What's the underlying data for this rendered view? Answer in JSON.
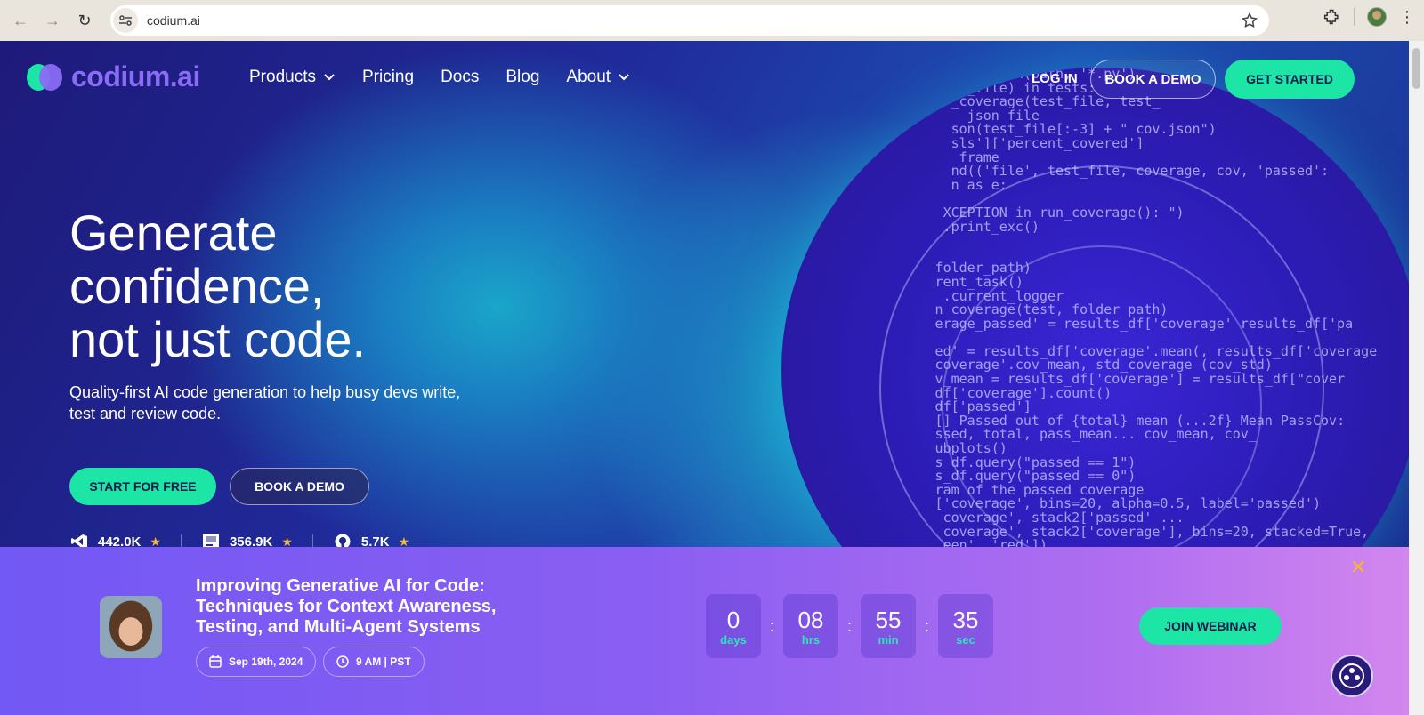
{
  "browser": {
    "url": "codium.ai"
  },
  "site": {
    "logo_text": "codium.ai",
    "nav": [
      {
        "label": "Products",
        "has_dropdown": true
      },
      {
        "label": "Pricing",
        "has_dropdown": false
      },
      {
        "label": "Docs",
        "has_dropdown": false
      },
      {
        "label": "Blog",
        "has_dropdown": false
      },
      {
        "label": "About",
        "has_dropdown": true
      }
    ],
    "login_label": "LOG IN",
    "book_demo_label": "BOOK A DEMO",
    "get_started_label": "GET STARTED"
  },
  "hero": {
    "title_line1": "Generate",
    "title_line2": "confidence,",
    "title_line3": "not just code.",
    "subtitle": "Quality-first AI code generation to help busy devs write, test and review code.",
    "start_free_label": "START FOR FREE",
    "book_demo_label": "BOOK A DEMO",
    "stats": [
      {
        "icon": "vscode-icon",
        "value": "442.0K"
      },
      {
        "icon": "jetbrains-icon",
        "value": "356.9K"
      },
      {
        "icon": "github-icon",
        "value": "5.7K"
      }
    ]
  },
  "webinar": {
    "title": "Improving Generative AI for Code: Techniques for Context Awareness, Testing, and Multi-Agent Systems",
    "date": "Sep 19th, 2024",
    "time": "9 AM | PST",
    "countdown": [
      {
        "value": "0",
        "label": "days"
      },
      {
        "value": "08",
        "label": "hrs"
      },
      {
        "value": "55",
        "label": "min"
      },
      {
        "value": "35",
        "label": "sec"
      }
    ],
    "join_label": "JOIN WEBINAR"
  },
  "colors": {
    "accent_green": "#1de5a6",
    "brand_purple": "#8b6cf6",
    "banner_start": "#7258f4",
    "banner_end": "#d286ee"
  }
}
